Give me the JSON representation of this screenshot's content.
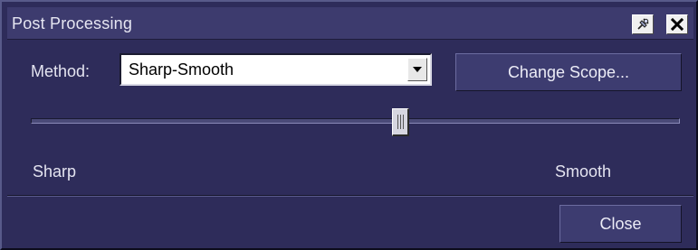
{
  "dialog": {
    "title": "Post Processing",
    "method_label": "Method:",
    "method_value": "Sharp-Smooth",
    "change_scope_label": "Change Scope...",
    "slider": {
      "min_label": "Sharp",
      "max_label": "Smooth",
      "value_fraction": 0.56
    },
    "close_label": "Close"
  },
  "icons": {
    "pin": "pin-icon",
    "close": "close-icon",
    "dropdown": "chevron-down-icon"
  },
  "colors": {
    "background": "#2e2c5a",
    "titlebar": "#3d3b6e",
    "button": "#3d3c70"
  }
}
